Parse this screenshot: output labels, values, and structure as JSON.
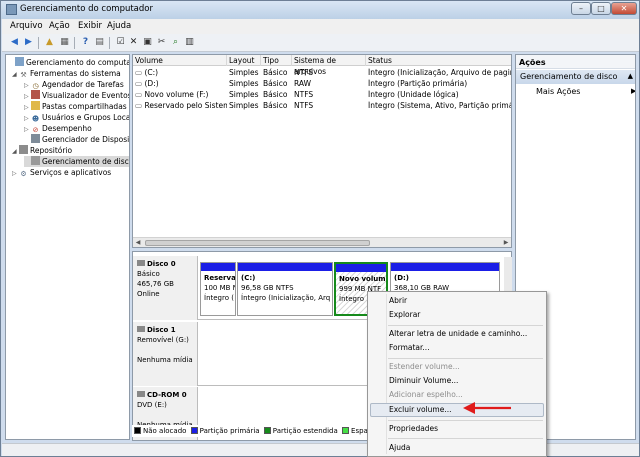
{
  "window": {
    "title": "Gerenciamento do computador"
  },
  "menu": [
    "Arquivo",
    "Ação",
    "Exibir",
    "Ajuda"
  ],
  "tree": [
    {
      "label": "Gerenciamento do computado",
      "icon": "computer-icon",
      "exp": ""
    },
    {
      "label": "Ferramentas do sistema",
      "icon": "tools-icon",
      "exp": "◢"
    },
    {
      "label": "Agendador de Tarefas",
      "icon": "clock-icon",
      "exp": "▷"
    },
    {
      "label": "Visualizador de Eventos",
      "icon": "event-icon",
      "exp": "▷"
    },
    {
      "label": "Pastas compartilhadas",
      "icon": "folder-icon",
      "exp": "▷"
    },
    {
      "label": "Usuários e Grupos Loca",
      "icon": "users-icon",
      "exp": "▷"
    },
    {
      "label": "Desempenho",
      "icon": "performance-icon",
      "exp": "▷"
    },
    {
      "label": "Gerenciador de Disposit",
      "icon": "device-icon",
      "exp": ""
    },
    {
      "label": "Repositório",
      "icon": "storage-icon",
      "exp": "◢"
    },
    {
      "label": "Gerenciamento de disco",
      "icon": "disk-icon",
      "exp": ""
    },
    {
      "label": "Serviços e aplicativos",
      "icon": "services-icon",
      "exp": "▷"
    }
  ],
  "list": {
    "headers": [
      "Volume",
      "Layout",
      "Tipo",
      "Sistema de arquivos",
      "Status"
    ],
    "rows": [
      [
        "(C:)",
        "Simples",
        "Básico",
        "NTFS",
        "Íntegro (Inicialização, Arquivo de paginaçã"
      ],
      [
        "(D:)",
        "Simples",
        "Básico",
        "RAW",
        "Íntegro (Partição primária)"
      ],
      [
        "Novo volume (F:)",
        "Simples",
        "Básico",
        "NTFS",
        "Íntegro (Unidade lógica)"
      ],
      [
        "Reservado pelo Sistema",
        "Simples",
        "Básico",
        "NTFS",
        "Íntegro (Sistema, Ativo, Partição primária)"
      ]
    ]
  },
  "disks": [
    {
      "name": "Disco 0",
      "lines": [
        "Básico",
        "465,76 GB",
        "Online"
      ],
      "partitions": [
        {
          "title": "Reserva",
          "line1": "100 MB N",
          "line2": "Íntegro ("
        },
        {
          "title": "(C:)",
          "line1": "96,58 GB NTFS",
          "line2": "Íntegro (Inicialização, Arq"
        },
        {
          "title": "Novo volum",
          "line1": "999 MB NTF",
          "line2": "Íntegro"
        },
        {
          "title": "(D:)",
          "line1": "368,10 GB RAW",
          "line2": ""
        }
      ]
    },
    {
      "name": "Disco 1",
      "lines": [
        "Removível (G:)",
        "",
        "Nenhuma mídia"
      ]
    },
    {
      "name": "CD-ROM 0",
      "lines": [
        "DVD (E:)",
        "",
        "Nenhuma mídia"
      ]
    }
  ],
  "legend": [
    {
      "label": "Não alocado",
      "color": "#000000"
    },
    {
      "label": "Partição primária",
      "color": "#1b1ee6"
    },
    {
      "label": "Partição estendida",
      "color": "#168a1b"
    },
    {
      "label": "Espaç",
      "color": "#46e046"
    }
  ],
  "actions": {
    "header": "Ações",
    "selected": "Gerenciamento de disco",
    "more": "Mais Ações"
  },
  "context_menu": {
    "items": [
      {
        "label": "Abrir",
        "disabled": false
      },
      {
        "label": "Explorar",
        "disabled": false
      },
      {
        "label": "Alterar letra de unidade e caminho...",
        "disabled": false
      },
      {
        "label": "Formatar...",
        "disabled": false
      },
      {
        "label": "Estender volume...",
        "disabled": true
      },
      {
        "label": "Diminuir Volume...",
        "disabled": false
      },
      {
        "label": "Adicionar espelho...",
        "disabled": true
      },
      {
        "label": "Excluir volume...",
        "disabled": false
      },
      {
        "label": "Propriedades",
        "disabled": false
      },
      {
        "label": "Ajuda",
        "disabled": false
      }
    ]
  },
  "colors": {
    "annotation_arrow": "#e01b1b",
    "primary_partition": "#1b1ee6",
    "selected_partition_border": "#168a1b"
  }
}
